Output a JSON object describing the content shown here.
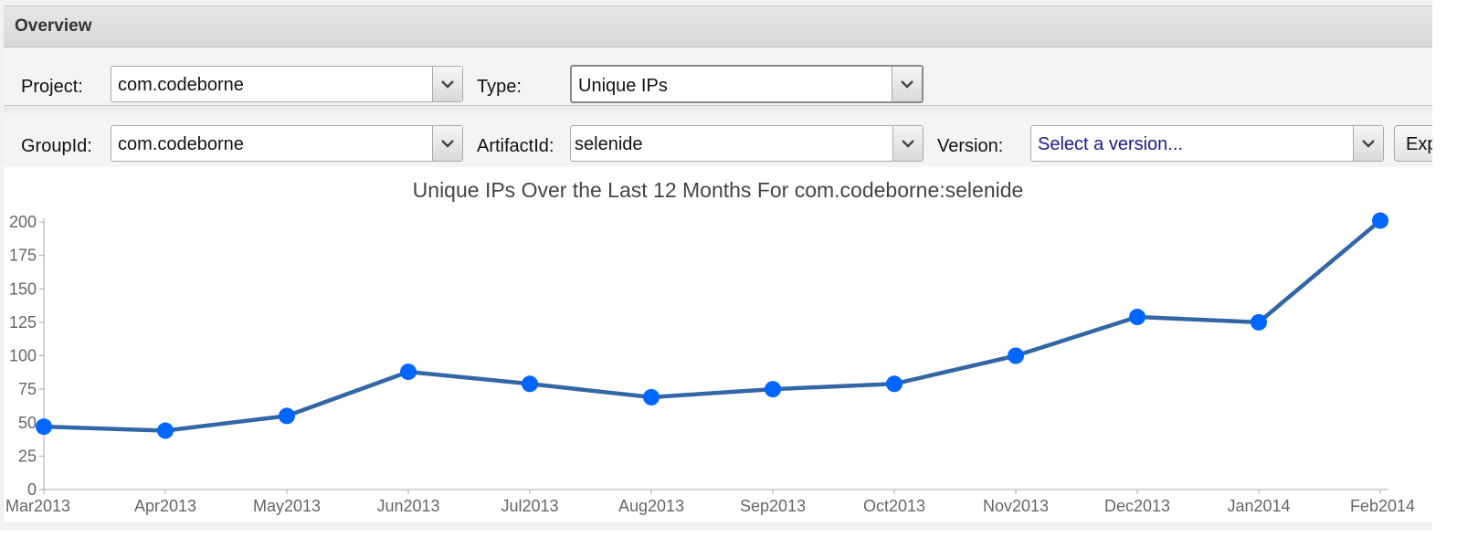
{
  "header": {
    "title": "Overview"
  },
  "filters": {
    "project_label": "Project:",
    "project_value": "com.codeborne",
    "type_label": "Type:",
    "type_value": "Unique IPs",
    "groupid_label": "GroupId:",
    "groupid_value": "com.codeborne",
    "artifactid_label": "ArtifactId:",
    "artifactid_value": "selenide",
    "version_label": "Version:",
    "version_placeholder": "Select a version...",
    "export_label": "Exp"
  },
  "chart_data": {
    "type": "line",
    "title": "Unique IPs Over the Last 12 Months For com.codeborne:selenide",
    "xlabel": "",
    "ylabel": "",
    "categories": [
      "Mar2013",
      "Apr2013",
      "May2013",
      "Jun2013",
      "Jul2013",
      "Aug2013",
      "Sep2013",
      "Oct2013",
      "Nov2013",
      "Dec2013",
      "Jan2014",
      "Feb2014"
    ],
    "series": [
      {
        "values": [
          47,
          44,
          55,
          88,
          79,
          69,
          75,
          79,
          100,
          129,
          125,
          201
        ]
      }
    ],
    "ylim": [
      0,
      200
    ],
    "yticks": [
      "0",
      "25",
      "50",
      "75",
      "100",
      "125",
      "150",
      "175",
      "200"
    ],
    "grid": false,
    "line_color": "#3366a6",
    "marker_color": "#0066ff"
  }
}
